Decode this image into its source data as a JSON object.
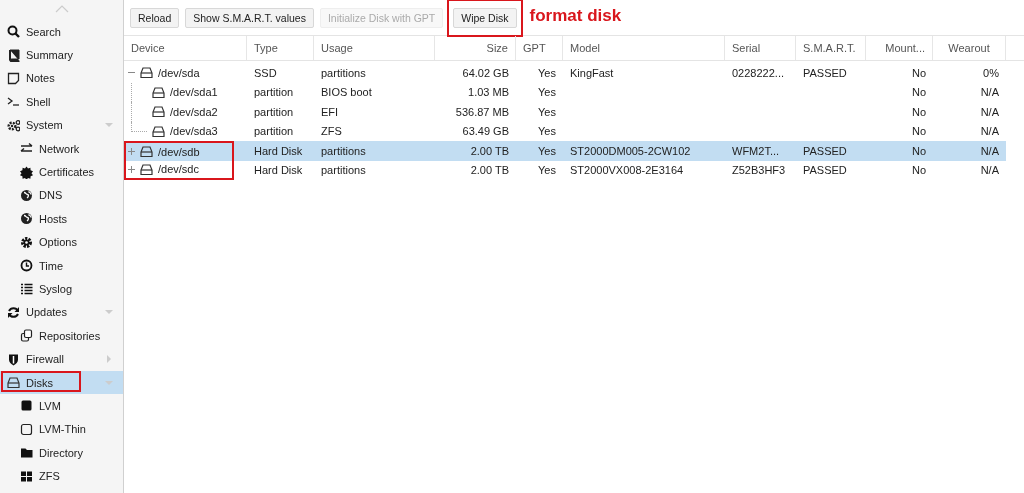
{
  "sidebar": {
    "items": [
      {
        "label": "Search",
        "selected": false
      },
      {
        "label": "Summary",
        "selected": false
      },
      {
        "label": "Notes",
        "selected": false
      },
      {
        "label": "Shell",
        "selected": false
      },
      {
        "label": "System",
        "selected": false,
        "expanded": true,
        "children": [
          {
            "label": "Network",
            "selected": false
          },
          {
            "label": "Certificates",
            "selected": false
          },
          {
            "label": "DNS",
            "selected": false
          },
          {
            "label": "Hosts",
            "selected": false
          },
          {
            "label": "Options",
            "selected": false
          },
          {
            "label": "Time",
            "selected": false
          },
          {
            "label": "Syslog",
            "selected": false
          }
        ]
      },
      {
        "label": "Updates",
        "selected": false,
        "expanded": true,
        "children": [
          {
            "label": "Repositories",
            "selected": false
          }
        ]
      },
      {
        "label": "Firewall",
        "selected": false,
        "expanded": false
      },
      {
        "label": "Disks",
        "selected": true,
        "highlighted": true,
        "expanded": true,
        "children": [
          {
            "label": "LVM",
            "selected": false
          },
          {
            "label": "LVM-Thin",
            "selected": false
          },
          {
            "label": "Directory",
            "selected": false
          },
          {
            "label": "ZFS",
            "selected": false
          }
        ]
      }
    ]
  },
  "toolbar": {
    "buttons": [
      {
        "label": "Reload",
        "disabled": false,
        "highlighted": false
      },
      {
        "label": "Show S.M.A.R.T. values",
        "disabled": false,
        "highlighted": false
      },
      {
        "label": "Initialize Disk with GPT",
        "disabled": true,
        "highlighted": false
      },
      {
        "label": "Wipe Disk",
        "disabled": false,
        "highlighted": true
      }
    ],
    "annotation": "format disk"
  },
  "table": {
    "columns": [
      "Device",
      "Type",
      "Usage",
      "Size",
      "GPT",
      "Model",
      "Serial",
      "S.M.A.R.T.",
      "Mount...",
      "Wearout"
    ],
    "rows": [
      {
        "cells": [
          "/dev/sda",
          "SSD",
          "partitions",
          "64.02 GB",
          "Yes",
          "KingFast",
          "0228222...",
          "PASSED",
          "No",
          "0%"
        ],
        "selected": false,
        "highlighted": false,
        "expanded": true,
        "children": [
          {
            "cells": [
              "/dev/sda1",
              "partition",
              "BIOS boot",
              "1.03 MB",
              "Yes",
              "",
              "",
              "",
              "No",
              "N/A"
            ],
            "selected": false,
            "highlighted": false
          },
          {
            "cells": [
              "/dev/sda2",
              "partition",
              "EFI",
              "536.87 MB",
              "Yes",
              "",
              "",
              "",
              "No",
              "N/A"
            ],
            "selected": false,
            "highlighted": false
          },
          {
            "cells": [
              "/dev/sda3",
              "partition",
              "ZFS",
              "63.49 GB",
              "Yes",
              "",
              "",
              "",
              "No",
              "N/A"
            ],
            "selected": false,
            "highlighted": false
          }
        ]
      },
      {
        "cells": [
          "/dev/sdb",
          "Hard Disk",
          "partitions",
          "2.00 TB",
          "Yes",
          "ST2000DM005-2CW102",
          "WFM2T...",
          "PASSED",
          "No",
          "N/A"
        ],
        "selected": true,
        "highlighted": true,
        "expanded": false
      },
      {
        "cells": [
          "/dev/sdc",
          "Hard Disk",
          "partitions",
          "2.00 TB",
          "Yes",
          "ST2000VX008-2E3164",
          "Z52B3HF3",
          "PASSED",
          "No",
          "N/A"
        ],
        "selected": false,
        "highlighted": true,
        "expanded": false
      }
    ]
  }
}
